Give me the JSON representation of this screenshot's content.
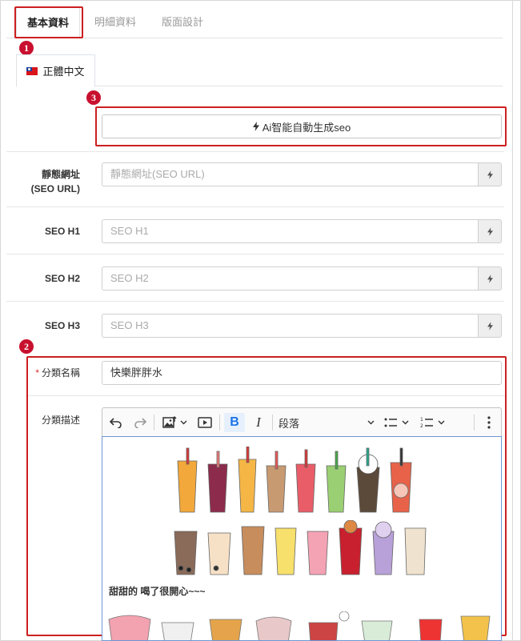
{
  "tabs": [
    {
      "label": "基本資料",
      "active": true
    },
    {
      "label": "明細資料",
      "active": false
    },
    {
      "label": "版面設計",
      "active": false
    }
  ],
  "language_tab": {
    "label": "正體中文",
    "flag": "taiwan-flag-icon"
  },
  "annotations": {
    "one": "1",
    "two": "2",
    "three": "3",
    "color": "#cc1f1f"
  },
  "ai_button": {
    "label": "Ai智能自動生成seo",
    "icon": "lightning-icon"
  },
  "fields": {
    "static_url": {
      "label_line1": "靜態網址",
      "label_line2": "(SEO URL)",
      "placeholder": "靜態網址(SEO URL)"
    },
    "seo_h1": {
      "label": "SEO H1",
      "placeholder": "SEO H1"
    },
    "seo_h2": {
      "label": "SEO H2",
      "placeholder": "SEO H2"
    },
    "seo_h3": {
      "label": "SEO H3",
      "placeholder": "SEO H3"
    },
    "category_name": {
      "required_mark": "*",
      "label": "分類名稱",
      "value": "快樂胖胖水"
    },
    "category_desc": {
      "label": "分類描述"
    }
  },
  "editor": {
    "toolbar": {
      "undo": "undo-icon",
      "redo": "redo-icon",
      "image": "image-upload-icon",
      "media": "media-embed-icon",
      "bold": "B",
      "italic": "I",
      "heading": "段落",
      "bullet_list": "bulleted-list-icon",
      "numbered_list": "numbered-list-icon",
      "more": "more-vertical-icon"
    },
    "caption": "甜甜的 喝了很開心~~~",
    "image_alt": "bubble-tea-illustrations"
  },
  "colors": {
    "accent_blue": "#1a73e8",
    "editor_border": "#6e99d6",
    "required": "#d9302c"
  }
}
